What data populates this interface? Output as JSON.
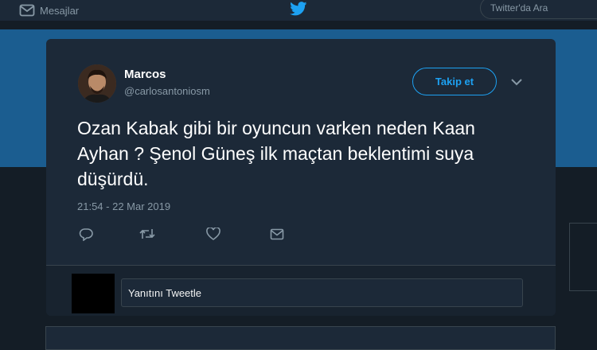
{
  "topbar": {
    "messages_label": "Mesajlar",
    "messages_icon": "envelope-icon",
    "logo_icon": "twitter-bird-icon",
    "search_placeholder": "Twitter'da Ara"
  },
  "tweet": {
    "author_name": "Marcos",
    "author_handle": "@carlosantoniosm",
    "follow_label": "Takip et",
    "text": "Ozan Kabak gibi bir oyuncun varken neden Kaan Ayhan ? Şenol Güneş ilk maçtan beklentimi suya düşürdü.",
    "timestamp": "21:54 - 22 Mar 2019",
    "actions": [
      "reply-icon",
      "retweet-icon",
      "like-icon",
      "direct-message-icon"
    ],
    "more_icon": "chevron-down-icon"
  },
  "reply": {
    "placeholder": "Yanıtını Tweetle"
  },
  "colors": {
    "background": "#141d26",
    "card": "#1c2938",
    "banner": "#1b5d90",
    "accent": "#1da1f2",
    "muted_text": "#8899a6",
    "border": "#38444d"
  }
}
